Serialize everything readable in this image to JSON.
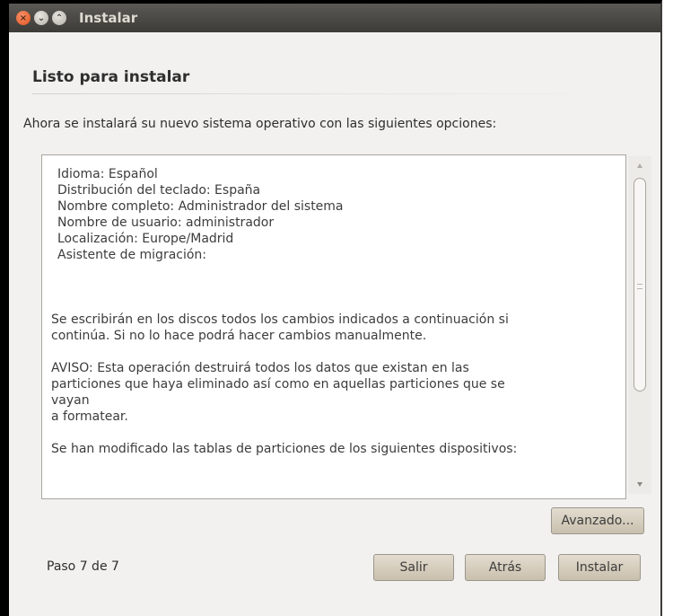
{
  "window": {
    "title": "Instalar"
  },
  "page": {
    "heading": "Listo para instalar",
    "intro": "Ahora se instalará su nuevo sistema operativo con las siguientes opciones:"
  },
  "summary": {
    "settings": [
      "Idioma: Español",
      "Distribución del teclado: España",
      "Nombre completo: Administrador del sistema",
      "Nombre de usuario: administrador",
      "Localización: Europe/Madrid",
      "Asistente de migración:"
    ],
    "paragraph1": [
      "Se escribirán en los discos todos los cambios indicados a continuación si",
      "continúa. Si no lo hace podrá hacer cambios manualmente."
    ],
    "paragraph2": [
      "AVISO: Esta operación destruirá todos los datos que existan en las",
      "particiones que haya eliminado así como en aquellas particiones que se",
      "vayan",
      "a formatear."
    ],
    "paragraph3": "Se han modificado las tablas de particiones de los siguientes dispositivos:"
  },
  "buttons": {
    "advanced": "Avanzado...",
    "quit": "Salir",
    "back": "Atrás",
    "install": "Instalar"
  },
  "footer": {
    "step": "Paso 7 de 7"
  }
}
